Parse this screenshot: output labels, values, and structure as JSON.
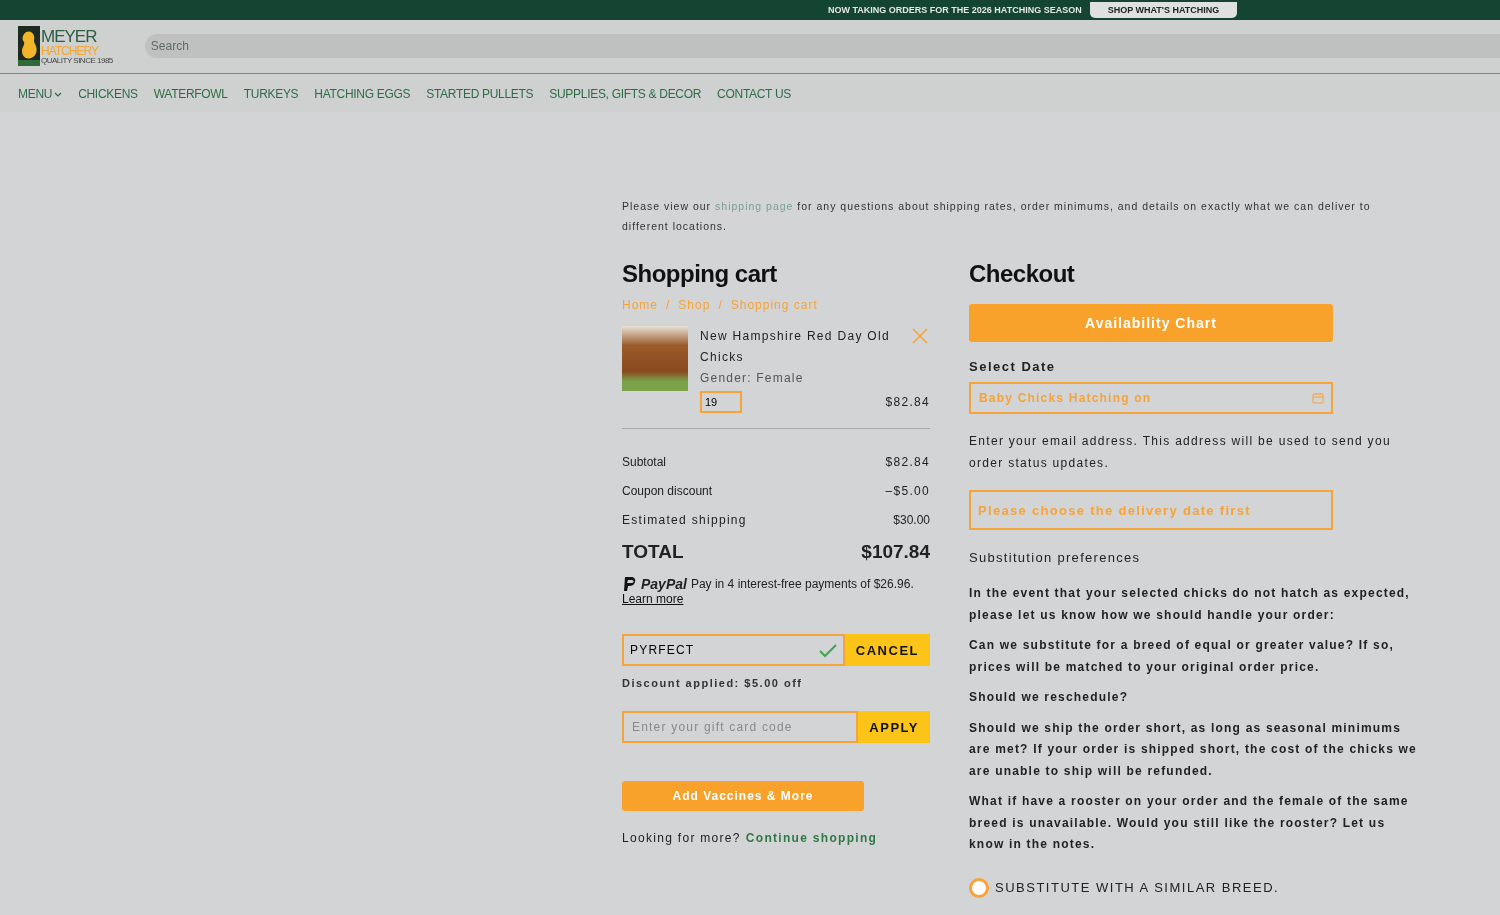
{
  "top_banner": {
    "text": "NOW TAKING ORDERS FOR THE 2026 HATCHING SEASON",
    "button": "SHOP WHAT'S HATCHING"
  },
  "header": {
    "logo": {
      "line1": "MEYER",
      "line2": "HATCHERY",
      "tagline": "QUALITY SINCE 1985"
    },
    "search": {
      "placeholder": "Search"
    }
  },
  "nav": [
    {
      "label": "MENU",
      "kind": "dropdown"
    },
    {
      "label": "CHICKENS",
      "kind": "link"
    },
    {
      "label": "WATERFOWL",
      "kind": "link"
    },
    {
      "label": "TURKEYS",
      "kind": "link"
    },
    {
      "label": "HATCHING EGGS",
      "kind": "link"
    },
    {
      "label": "STARTED PULLETS",
      "kind": "link"
    },
    {
      "label": "SUPPLIES, GIFTS & DECOR",
      "kind": "link"
    },
    {
      "label": "CONTACT US",
      "kind": "link"
    }
  ],
  "notice": {
    "before": "Please view our ",
    "link": "shipping page",
    "after": " for any questions about shipping rates, order minimums, and details on exactly what we can deliver to different locations."
  },
  "cart": {
    "title": "Shopping cart",
    "breadcrumb": [
      "Home",
      "Shop",
      "Shopping cart"
    ],
    "breadcrumb_separator": "/",
    "item": {
      "name": "New Hampshire Red Day Old Chicks",
      "gender": "Gender: Female",
      "quantity": "19",
      "price": "$82.84"
    },
    "summary": [
      {
        "label": "Subtotal",
        "value": "$82.84",
        "kind": "line"
      },
      {
        "label": "Coupon discount",
        "value": "–$5.00",
        "kind": "line"
      },
      {
        "label": "Estimated shipping",
        "value": "$30.00",
        "kind": "line"
      },
      {
        "label": "TOTAL",
        "value": "$107.84",
        "kind": "total"
      }
    ],
    "paypal": {
      "brand": "PayPal",
      "text": "Pay in 4 interest-free payments of $26.96.",
      "link": "Learn more"
    },
    "coupon": {
      "value": "PYRFECT",
      "applied": true,
      "button": "CANCEL"
    },
    "discount_message": "Discount applied: $5.00 off",
    "gift_card": {
      "placeholder": "Enter your gift card code",
      "button": "APPLY"
    },
    "add_button": "Add Vaccines & More",
    "footer": {
      "text": "Looking for more?",
      "link": "Continue shopping"
    }
  },
  "checkout": {
    "title": "Checkout",
    "availability_button": "Availability Chart",
    "select_date_label": "Select Date",
    "date_field": {
      "placeholder": "Baby Chicks Hatching on"
    },
    "email_note": "Enter your email address. This address will be used to send you order status updates.",
    "delivery_field": {
      "placeholder": "Please choose the delivery date first"
    },
    "substitution_title": "Substitution preferences",
    "paragraphs": [
      "In the event that your selected chicks do not hatch as expected, please let us know how we should handle your order:",
      "Can we substitute for a breed of equal or greater value? If so, prices will be matched to your original order price.",
      "Should we reschedule?",
      "Should we ship the order short, as long as seasonal minimums are met? If your order is shipped short, the cost of the chicks we are unable to ship will be refunded.",
      "What if have a rooster on your order and the female of the same breed is unavailable. Would you still like the rooster? Let us know in the notes."
    ],
    "options": [
      {
        "label": "SUBSTITUTE WITH A SIMILAR BREED.",
        "selected": false
      }
    ]
  }
}
